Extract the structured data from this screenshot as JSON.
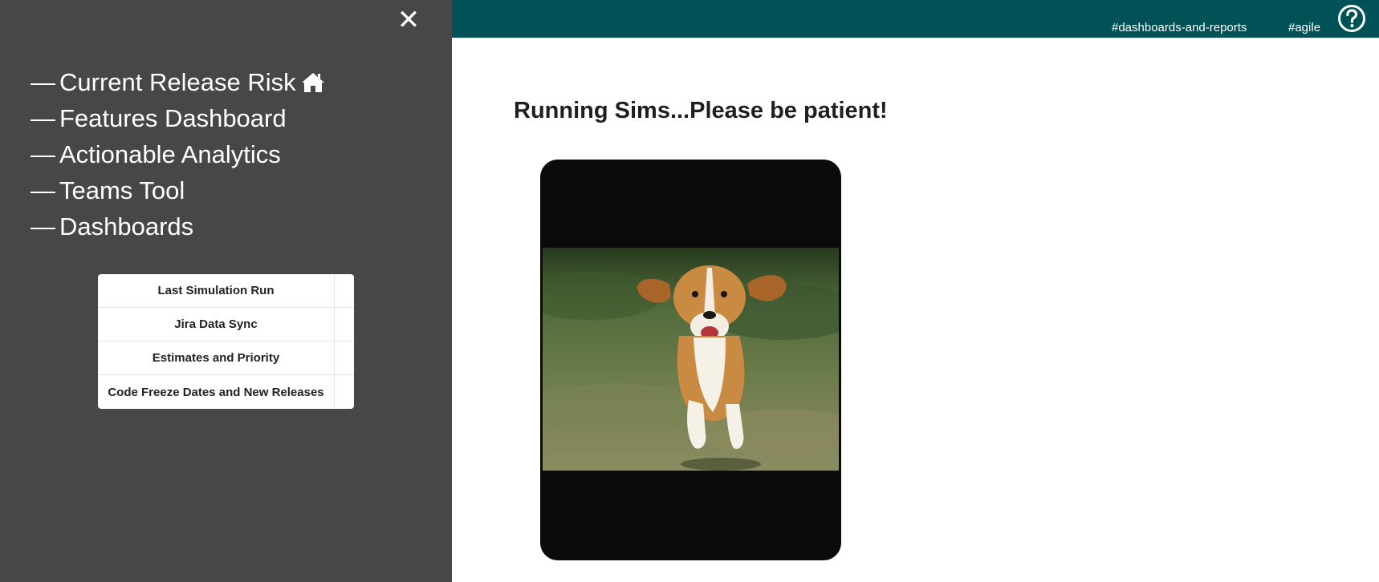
{
  "sidebar": {
    "close_label": "✕",
    "nav": [
      {
        "dash": "—",
        "label": "Current Release Risk",
        "icon": "home-icon"
      },
      {
        "dash": "—",
        "label": "Features Dashboard"
      },
      {
        "dash": "—",
        "label": "Actionable Analytics"
      },
      {
        "dash": "—",
        "label": "Teams Tool"
      },
      {
        "dash": "—",
        "label": "Dashboards"
      }
    ],
    "status_table": [
      {
        "label": "Last Simulation Run",
        "value": ""
      },
      {
        "label": "Jira Data Sync",
        "value": ""
      },
      {
        "label": "Estimates and Priority",
        "value": ""
      },
      {
        "label": "Code Freeze Dates and New Releases",
        "value": ""
      }
    ]
  },
  "topbar": {
    "links": [
      "#dashboards-and-reports",
      "#agile"
    ],
    "help_icon": "question-circle-icon",
    "color": "#005256"
  },
  "main": {
    "title": "Running Sims...Please be patient!",
    "loading_image": "running-beagle-photo"
  },
  "colors": {
    "sidebar_bg": "#474747",
    "topbar_bg": "#005256",
    "frame_bg": "#0b0b0b"
  }
}
